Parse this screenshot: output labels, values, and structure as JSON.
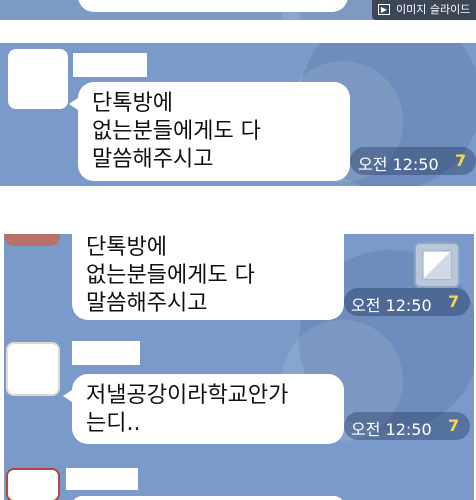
{
  "slideshow_button": {
    "label": "이미지 슬라이드",
    "icon": "slideshow-icon"
  },
  "messages": [
    {
      "text": "단톡방에\n없는분들에게도 다\n말씀해주시고",
      "time": "오전 12:50",
      "unread": "7"
    },
    {
      "text": "단톡방에\n없는분들에게도 다\n말씀해주시고",
      "time": "오전 12:50",
      "unread": "7"
    },
    {
      "text": "저낼공강이라학교안가\n는디..",
      "time": "오전 12:50",
      "unread": "7"
    }
  ],
  "colors": {
    "chat_bg": "#7a9bc9",
    "bubble": "#ffffff",
    "unread": "#f5d94a"
  }
}
